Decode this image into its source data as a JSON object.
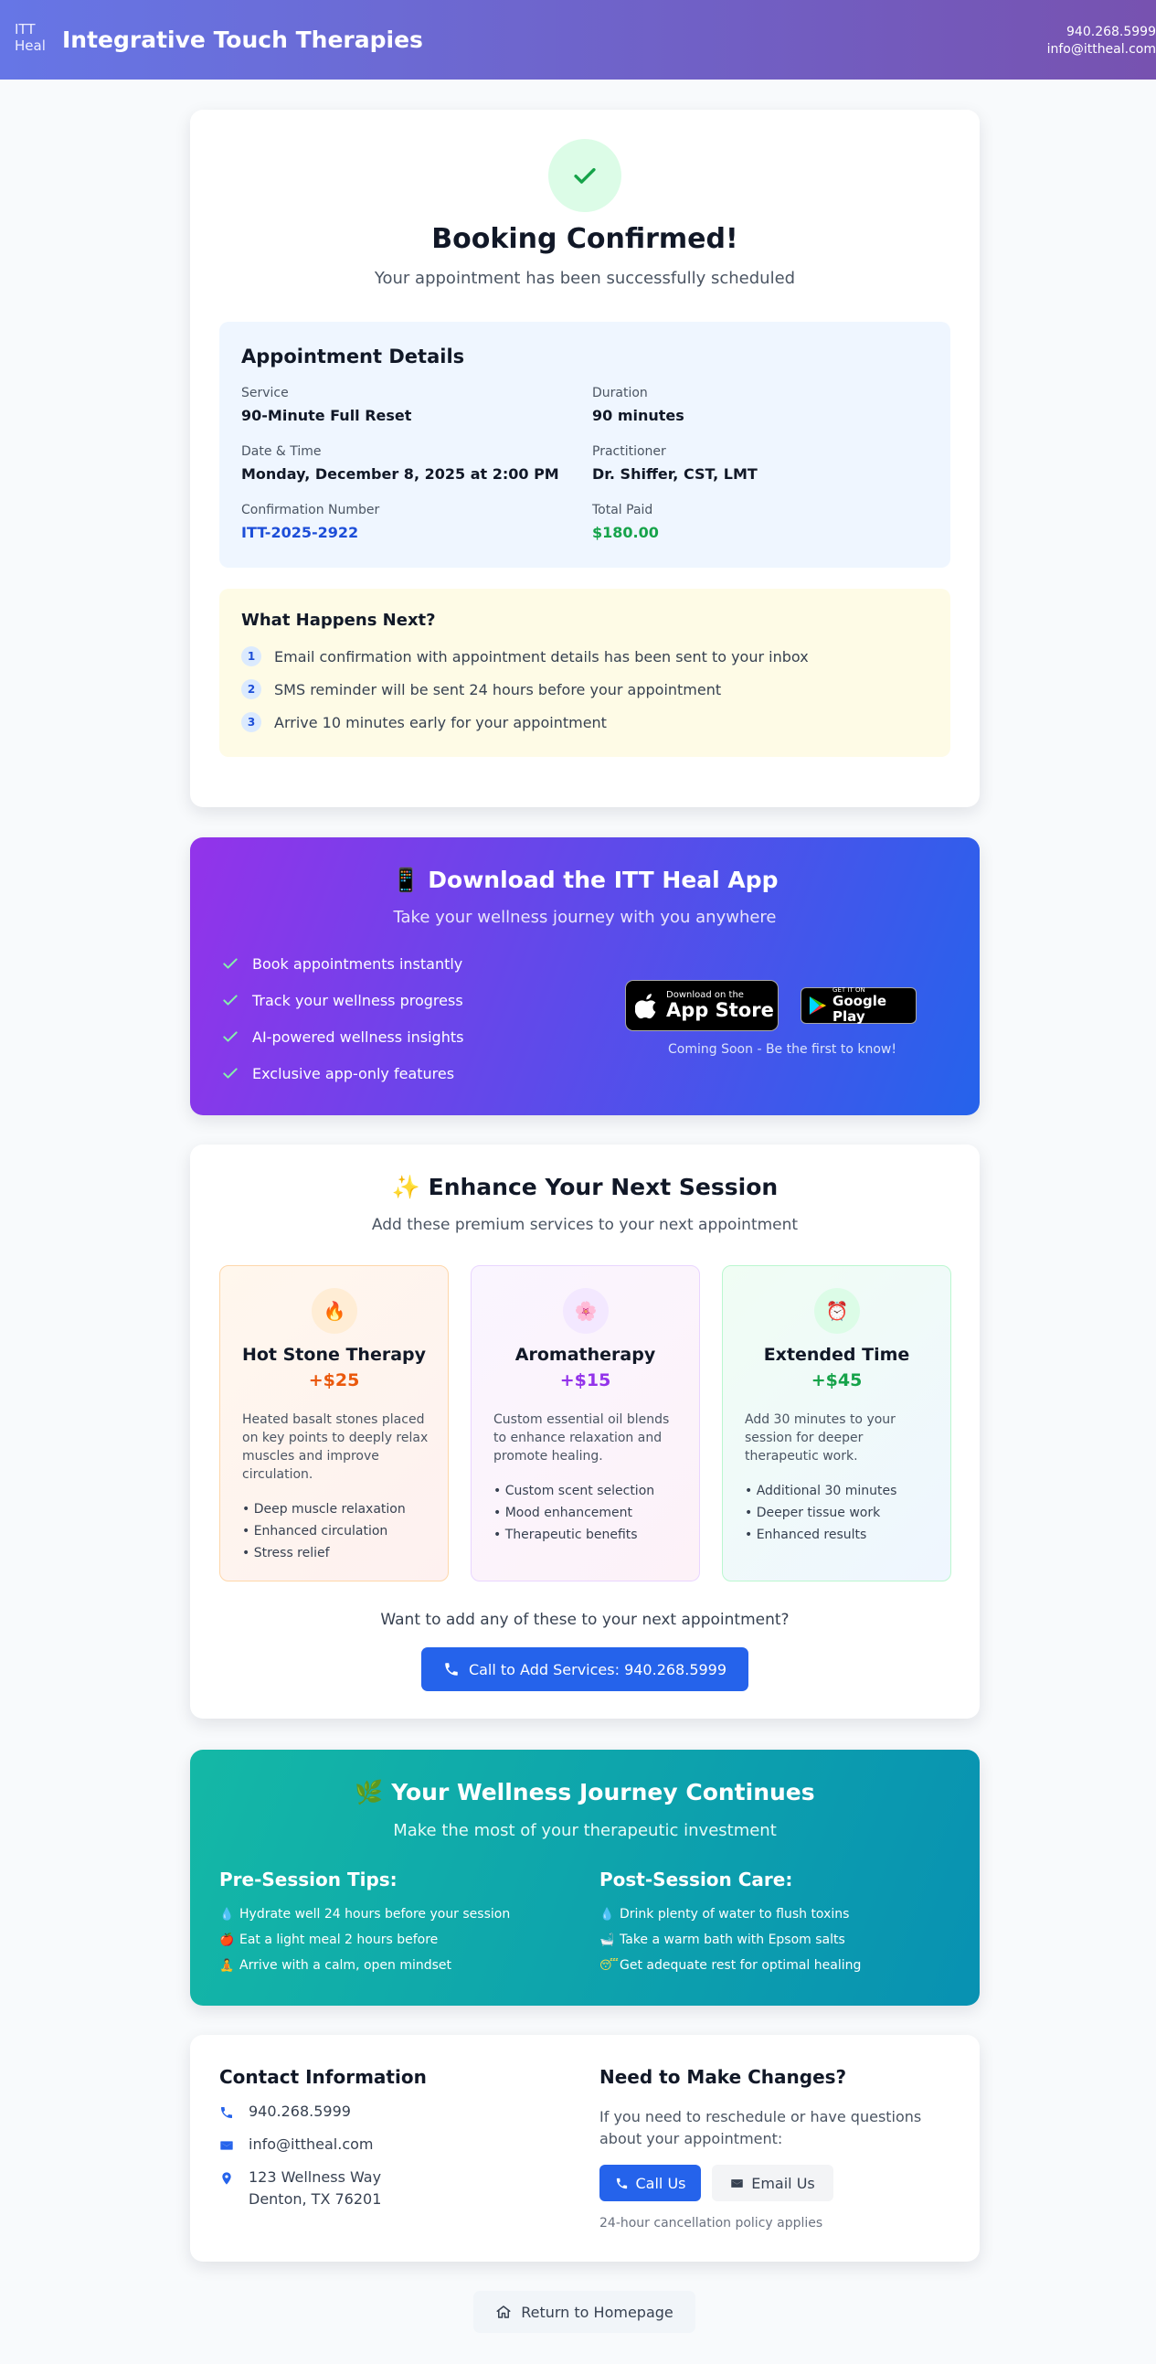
{
  "header": {
    "logo_alt": "ITT Heal",
    "brand": "Integrative Touch Therapies",
    "phone": "940.268.5999",
    "email": "info@ittheal.com"
  },
  "confirmation": {
    "title": "Booking Confirmed!",
    "subtitle": "Your appointment has been successfully scheduled",
    "details": {
      "heading": "Appointment Details",
      "service_label": "Service",
      "service": "90-Minute Full Reset",
      "duration_label": "Duration",
      "duration": "90 minutes",
      "datetime_label": "Date & Time",
      "datetime": "Monday, December 8, 2025 at 2:00 PM",
      "practitioner_label": "Practitioner",
      "practitioner": "Dr. Shiffer, CST, LMT",
      "confirmation_label": "Confirmation Number",
      "confirmation_number": "ITT-2025-2922",
      "total_label": "Total Paid",
      "total": "$180.00"
    },
    "next": {
      "heading": "What Happens Next?",
      "steps": [
        {
          "num": "1",
          "text": "Email confirmation with appointment details has been sent to your inbox"
        },
        {
          "num": "2",
          "text": "SMS reminder will be sent 24 hours before your appointment"
        },
        {
          "num": "3",
          "text": "Arrive 10 minutes early for your appointment"
        }
      ]
    }
  },
  "app": {
    "title": "📱 Download the ITT Heal App",
    "subtitle": "Take your wellness journey with you anywhere",
    "features": [
      "Book appointments instantly",
      "Track your wellness progress",
      "AI-powered wellness insights",
      "Exclusive app-only features"
    ],
    "appstore_small": "Download on the",
    "appstore_big": "App Store",
    "googleplay_small": "GET IT ON",
    "googleplay_big": "Google Play",
    "coming_soon": "Coming Soon - Be the first to know!"
  },
  "enhance": {
    "title": "✨ Enhance Your Next Session",
    "subtitle": "Add these premium services to your next appointment",
    "services": [
      {
        "icon": "🔥",
        "name": "Hot Stone Therapy",
        "price": "+$25",
        "color": "#ea580c",
        "description": "Heated basalt stones placed on key points to deeply relax muscles and improve circulation.",
        "bullets": [
          "• Deep muscle relaxation",
          "• Enhanced circulation",
          "• Stress relief"
        ]
      },
      {
        "icon": "🌸",
        "name": "Aromatherapy",
        "price": "+$15",
        "color": "#9333ea",
        "description": "Custom essential oil blends to enhance relaxation and promote healing.",
        "bullets": [
          "• Custom scent selection",
          "• Mood enhancement",
          "• Therapeutic benefits"
        ]
      },
      {
        "icon": "⏰",
        "name": "Extended Time",
        "price": "+$45",
        "color": "#16a34a",
        "description": "Add 30 minutes to your session for deeper therapeutic work.",
        "bullets": [
          "• Additional 30 minutes",
          "• Deeper tissue work",
          "• Enhanced results"
        ]
      }
    ],
    "prompt": "Want to add any of these to your next appointment?",
    "call_button": "Call to Add Services: 940.268.5999"
  },
  "wellness": {
    "title": "🌿 Your Wellness Journey Continues",
    "subtitle": "Make the most of your therapeutic investment",
    "pre_heading": "Pre-Session Tips:",
    "pre_tips": [
      {
        "icon": "💧",
        "text": "Hydrate well 24 hours before your session"
      },
      {
        "icon": "🍎",
        "text": "Eat a light meal 2 hours before"
      },
      {
        "icon": "🧘",
        "text": "Arrive with a calm, open mindset"
      }
    ],
    "post_heading": "Post-Session Care:",
    "post_tips": [
      {
        "icon": "💧",
        "text": "Drink plenty of water to flush toxins"
      },
      {
        "icon": "🛁",
        "text": "Take a warm bath with Epsom salts"
      },
      {
        "icon": "😴",
        "text": "Get adequate rest for optimal healing"
      }
    ]
  },
  "contact": {
    "heading": "Contact Information",
    "phone": "940.268.5999",
    "email": "info@ittheal.com",
    "address_line1": "123 Wellness Way",
    "address_line2": "Denton, TX 76201",
    "changes_heading": "Need to Make Changes?",
    "changes_text": "If you need to reschedule or have questions about your appointment:",
    "call_us": "Call Us",
    "email_us": "Email Us",
    "policy": "24-hour cancellation policy applies"
  },
  "footer": {
    "return_home": "Return to Homepage"
  },
  "colors": {
    "primary_blue": "#2563eb",
    "success_green": "#16a34a",
    "header_gradient_start": "#6676e6",
    "header_gradient_end": "#7752b0"
  }
}
